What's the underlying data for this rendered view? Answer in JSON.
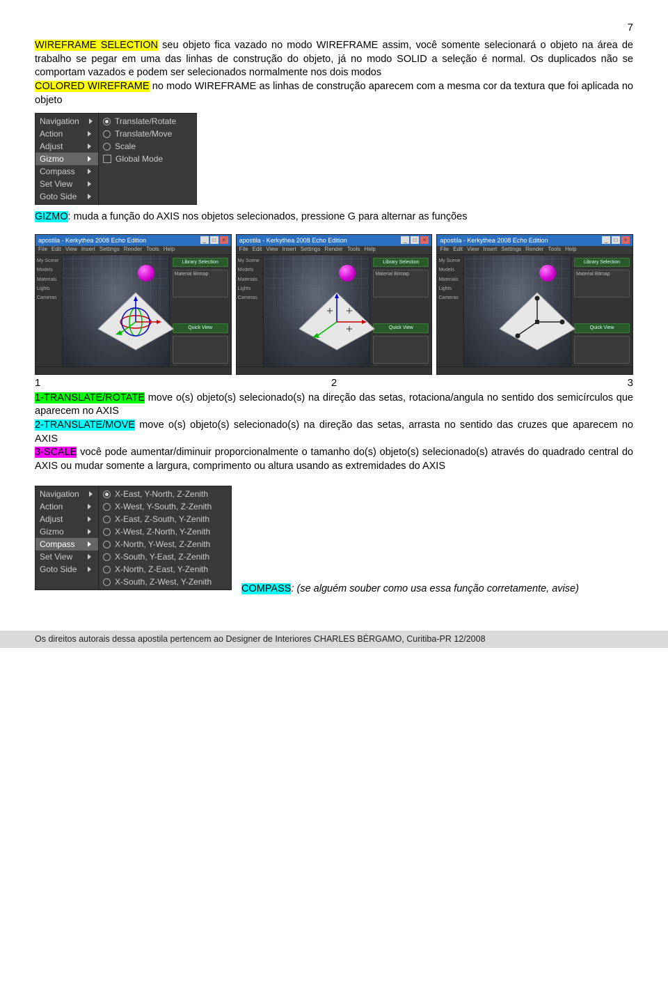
{
  "page_number": "7",
  "p1": {
    "hl1": "WIREFRAME SELECTION",
    "t1": " seu objeto fica vazado no modo WIREFRAME assim, você somente selecionará o objeto na área de trabalho se pegar em uma das linhas de construção do objeto, já no modo SOLID a seleção é normal. Os duplicados não se comportam vazados e podem ser selecionados normalmente nos dois modos",
    "hl2": "COLORED WIREFRAME",
    "t2": " no modo WIREFRAME as linhas de construção aparecem com a mesma cor da textura que foi aplicada no objeto"
  },
  "gizmo_menu": {
    "left": [
      "Navigation",
      "Action",
      "Adjust",
      "Gizmo",
      "Compass",
      "Set View",
      "Goto Side"
    ],
    "selected": "Gizmo",
    "right": [
      {
        "label": "Translate/Rotate",
        "on": true
      },
      {
        "label": "Translate/Move",
        "on": false
      },
      {
        "label": "Scale",
        "on": false
      }
    ],
    "checkbox": "Global Mode"
  },
  "p2": {
    "hl": "GIZMO",
    "t": ": muda a função do AXIS nos objetos selecionados, pressione G para alternar as funções"
  },
  "thumb_common": {
    "title": "apostila - Kerkythea 2008 Echo Edition",
    "menubar": [
      "File",
      "Edit",
      "View",
      "Insert",
      "Settings",
      "Render",
      "Tools",
      "Help"
    ],
    "side_labels": [
      "My Scene",
      "Models",
      "Materials",
      "Lights",
      "Cameras"
    ],
    "right_btn1": "Library Selection",
    "right_btn2": "Material Bitmap",
    "right_btn3": "Quick View",
    "win_btns": [
      "_",
      "□",
      "×"
    ]
  },
  "tri_row": {
    "a": "1",
    "b": "2",
    "c": "3"
  },
  "p3": {
    "hl_a": "1-TRANSLATE/ROTATE",
    "t_a": " move o(s) objeto(s) selecionado(s) na direção das setas, rotaciona/angula no sentido dos semicírculos que aparecem no AXIS",
    "hl_b": "2-TRANSLATE/MOVE",
    "t_b": " move o(s) objeto(s) selecionado(s) na direção das setas, arrasta no sentido das cruzes que aparecem no AXIS",
    "hl_c": "3-SCALE",
    "t_c": " você pode aumentar/diminuir proporcionalmente o tamanho do(s) objeto(s) selecionado(s) através do quadrado central do AXIS ou mudar somente a largura, comprimento ou altura usando as extremidades do AXIS"
  },
  "compass_menu": {
    "left": [
      "Navigation",
      "Action",
      "Adjust",
      "Gizmo",
      "Compass",
      "Set View",
      "Goto Side"
    ],
    "selected": "Compass",
    "right": [
      {
        "label": "X-East, Y-North, Z-Zenith",
        "on": true
      },
      {
        "label": "X-West, Y-South, Z-Zenith",
        "on": false
      },
      {
        "label": "X-East, Z-South, Y-Zenith",
        "on": false
      },
      {
        "label": "X-West, Z-North, Y-Zenith",
        "on": false
      },
      {
        "label": "X-North, Y-West, Z-Zenith",
        "on": false
      },
      {
        "label": "X-South, Y-East, Z-Zenith",
        "on": false
      },
      {
        "label": "X-North, Z-East, Y-Zenith",
        "on": false
      },
      {
        "label": "X-South, Z-West, Y-Zenith",
        "on": false
      }
    ]
  },
  "p4": {
    "hl": "COMPASS",
    "t": ": (se alguém souber como usa essa função corretamente, avise)"
  },
  "footer": "Os direitos autorais dessa apostila pertencem ao Designer de Interiores CHARLES BÉRGAMO, Curitiba-PR 12/2008"
}
